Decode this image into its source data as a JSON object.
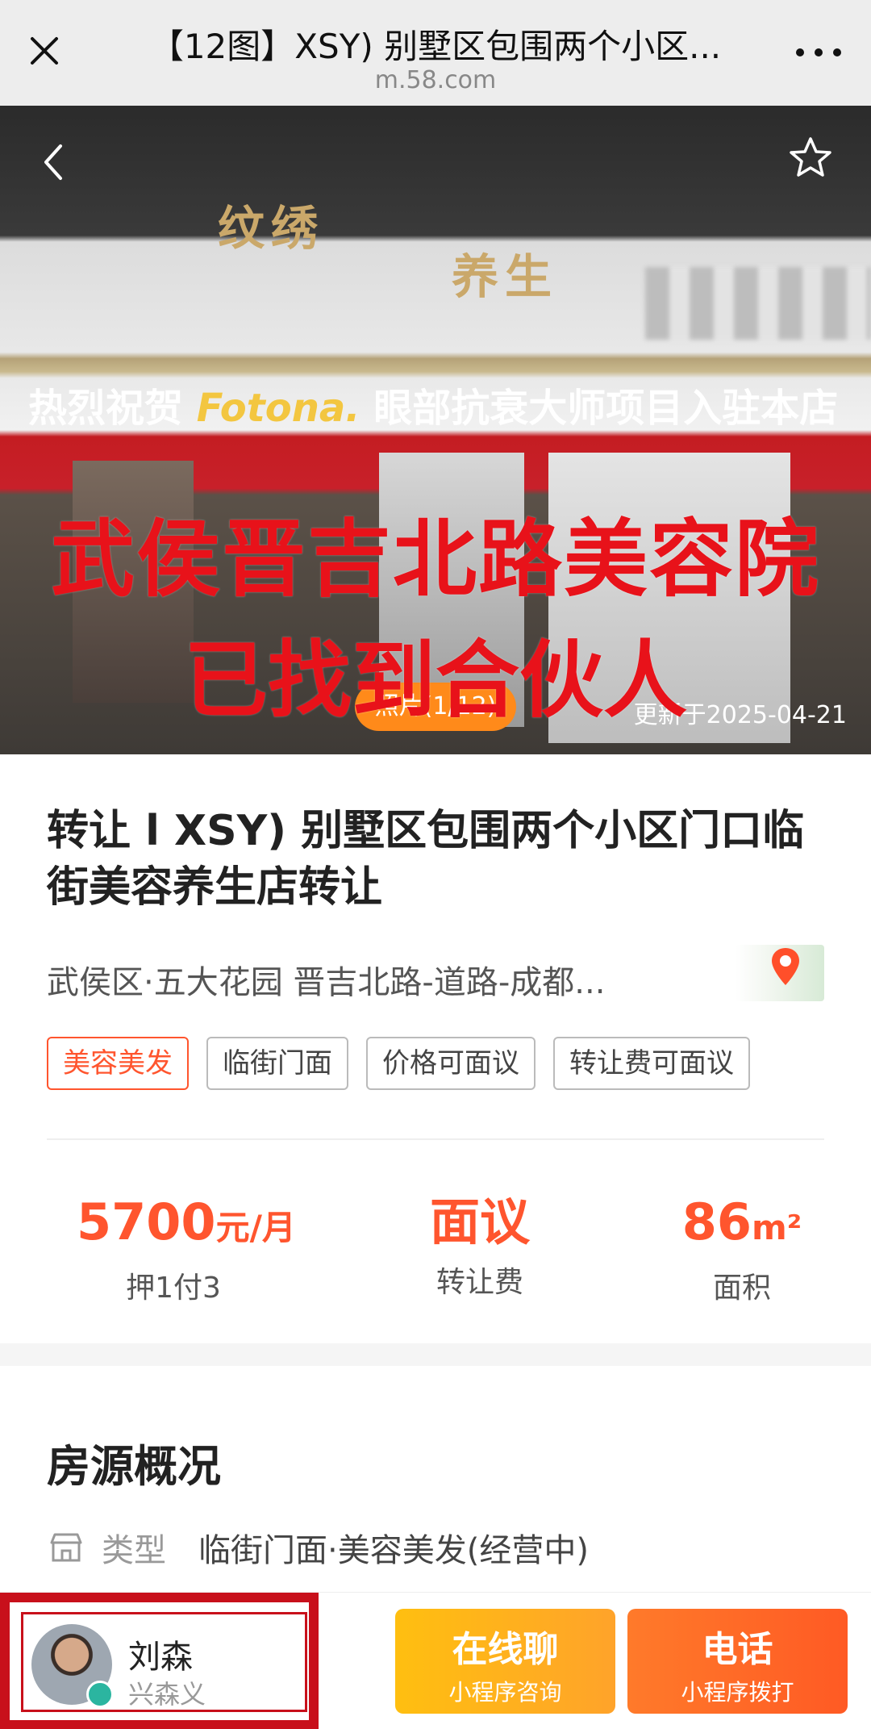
{
  "browser": {
    "title": "【12图】XSY) 别墅区包围两个小区...",
    "url": "m.58.com"
  },
  "hero": {
    "shop_sign_1": "纹绣",
    "shop_sign_2": "养生",
    "banner_prefix": "热烈祝贺",
    "banner_brand": "Fotona.",
    "banner_suffix": "眼部抗衰大师项目入驻本店",
    "overlay_line1": "武侯晋吉北路美容院",
    "overlay_line2": "已找到合伙人",
    "photo_counter": "照片(1/12)",
    "updated": "更新于2025-04-21"
  },
  "listing": {
    "headline": "转让 l XSY) 别墅区包围两个小区门口临街美容养生店转让",
    "address": "武侯区·五大花园 晋吉北路-道路-成都...",
    "tags": [
      "美容美发",
      "临街门面",
      "价格可面议",
      "转让费可面议"
    ],
    "stats": {
      "rent_value": "5700",
      "rent_unit": "元/月",
      "rent_label": "押1付3",
      "transfer_value": "面议",
      "transfer_label": "转让费",
      "area_value": "86",
      "area_unit": "m²",
      "area_label": "面积"
    }
  },
  "overview": {
    "heading": "房源概况",
    "type_key": "类型",
    "type_value": "临街门面·美容美发(经营中)"
  },
  "agent": {
    "name": "刘森",
    "company": "兴森义"
  },
  "actions": {
    "chat_main": "在线聊",
    "chat_sub": "小程序咨询",
    "call_main": "电话",
    "call_sub": "小程序拨打"
  },
  "colors": {
    "accent": "#ff552e",
    "overlay_red": "#e8121a",
    "chat_btn": "#ffb020",
    "call_btn": "#ff6a28",
    "highlight_frame": "#c8101b"
  }
}
